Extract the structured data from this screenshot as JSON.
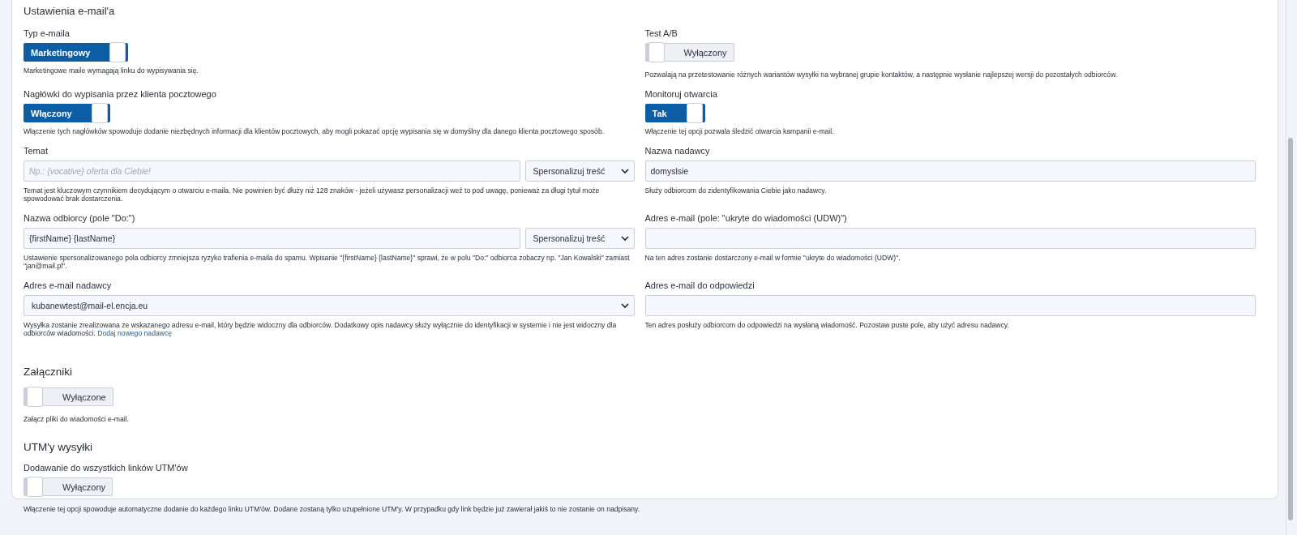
{
  "section_title": "Ustawienia e-mail'a",
  "rows": [
    {
      "left": {
        "kind": "toggle",
        "label": "Typ e-maila",
        "state_text": "Marketingowy",
        "on": true,
        "help": "Marketingowe maile wymagają linku do wypisywania się."
      },
      "right": {
        "kind": "toggle",
        "label": "Test A/B",
        "state_text": "Wyłączony",
        "on": false,
        "help": "Pozwalają na przetestowanie różnych wariantów wysyłki na wybranej grupie kontaktów, a następnie wysłanie najlepszej wersji do pozostałych odbiorców."
      }
    },
    {
      "left": {
        "kind": "toggle",
        "label": "Nagłówki do wypisania przez klienta pocztowego",
        "state_text": "Włączony",
        "on": true,
        "help": "Włączenie tych nagłówków spowoduje dodanie niezbędnych informacji dla klientów pocztowych, aby mogli pokazać opcję wypisania się w domyślny dla danego klienta pocztowego sposób."
      },
      "right": {
        "kind": "toggle",
        "label": "Monitoruj otwarcia",
        "state_text": "Tak",
        "on": true,
        "help": "Włączenie tej opcji pozwala śledzić otwarcia kampanii e-mail."
      }
    },
    {
      "left": {
        "kind": "text_select",
        "label": "Temat",
        "placeholder": "Np.: {vocative} oferta dla Ciebie!",
        "select": "Spersonalizuj treść",
        "help": "Temat jest kluczowym czynnikiem decydującym o otwarciu e-maila. Nie powinien być dłuży niż 128 znaków - jeżeli używasz personalizacji weź to pod uwagę, ponieważ za długi tytuł może spowodować brak dostarczenia."
      },
      "right": {
        "kind": "text",
        "label": "Nazwa nadawcy",
        "value": "domyslsie",
        "help": "Służy odbiorcom do zidentyfikowania Ciebie jako nadawcy."
      }
    },
    {
      "left": {
        "kind": "text_select",
        "label": "Nazwa odbiorcy (pole \"Do:\")",
        "value": "{firstName} {lastName}",
        "select": "Spersonalizuj treść",
        "help": "Ustawienie spersonalizowanego pola odbiorcy zmniejsza ryzyko trafienia e-maila do spamu. Wpisanie \"{firstName} {lastName}\" sprawi, że w polu \"Do:\" odbiorca zobaczy np. \"Jan Kowalski\" zamiast \"jan@mail.pl\"."
      },
      "right": {
        "kind": "text",
        "label": "Adres e-mail (pole: \"ukryte do wiadomości (UDW)\")",
        "help": "Na ten adres zostanie dostarczony e-mail w formie \"ukryte do wiadomości (UDW)\"."
      }
    },
    {
      "left": {
        "kind": "select",
        "label": "Adres e-mail nadawcy",
        "value": "kubanewtest@mail-el.encja.eu",
        "help": "Wysyłka zostanie zrealizowana ze wskazanego adresu e-mail, który będzie widoczny dla odbiorców. Dodatkowy opis nadawcy służy wyłącznie do identyfikacji w systemie i nie jest widoczny dla odbiorców wiadomości.",
        "help_link": "Dodaj nowego nadawcę"
      },
      "right": {
        "kind": "text",
        "label": "Adres e-mail do odpowiedzi",
        "help": "Ten adres posłuży odbiorcom do odpowiedzi na wysłaną wiadomość. Pozostaw puste pole, aby użyć adresu nadawcy."
      }
    }
  ],
  "attachments": {
    "title": "Załączniki",
    "state_text": "Wyłączone",
    "on": false,
    "help": "Załącz pliki do wiadomości e-mail."
  },
  "utm": {
    "title": "UTM'y wysyłki",
    "label": "Dodawanie do wszystkich linków UTM'ów",
    "state_text": "Wyłączony",
    "on": false,
    "help": "Włączenie tej opcji spowoduje automatyczne dodanie do każdego linku UTM'ów. Dodane zostaną tylko uzupełnione UTM'y. W przypadku gdy link będzie już zawierał jakiś to nie zostanie on nadpisany."
  }
}
